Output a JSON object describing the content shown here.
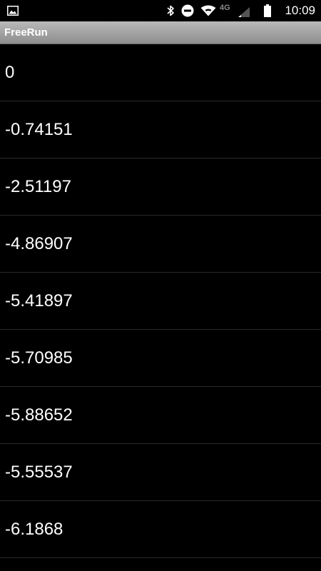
{
  "status_bar": {
    "time": "10:09",
    "network_label": "4G",
    "icons": [
      "image-notification-icon",
      "bluetooth-icon",
      "do-not-disturb-icon",
      "wifi-icon",
      "cell-signal-icon",
      "battery-icon"
    ]
  },
  "app": {
    "title": "FreeRun"
  },
  "list": {
    "items": [
      "0",
      "-0.74151",
      "-2.51197",
      "-4.86907",
      "-5.41897",
      "-5.70985",
      "-5.88652",
      "-5.55537",
      "-6.1868"
    ]
  },
  "colors": {
    "background": "#000000",
    "title_bar": "#a3a3a3",
    "text": "#ffffff",
    "divider": "#2a2a2a"
  }
}
